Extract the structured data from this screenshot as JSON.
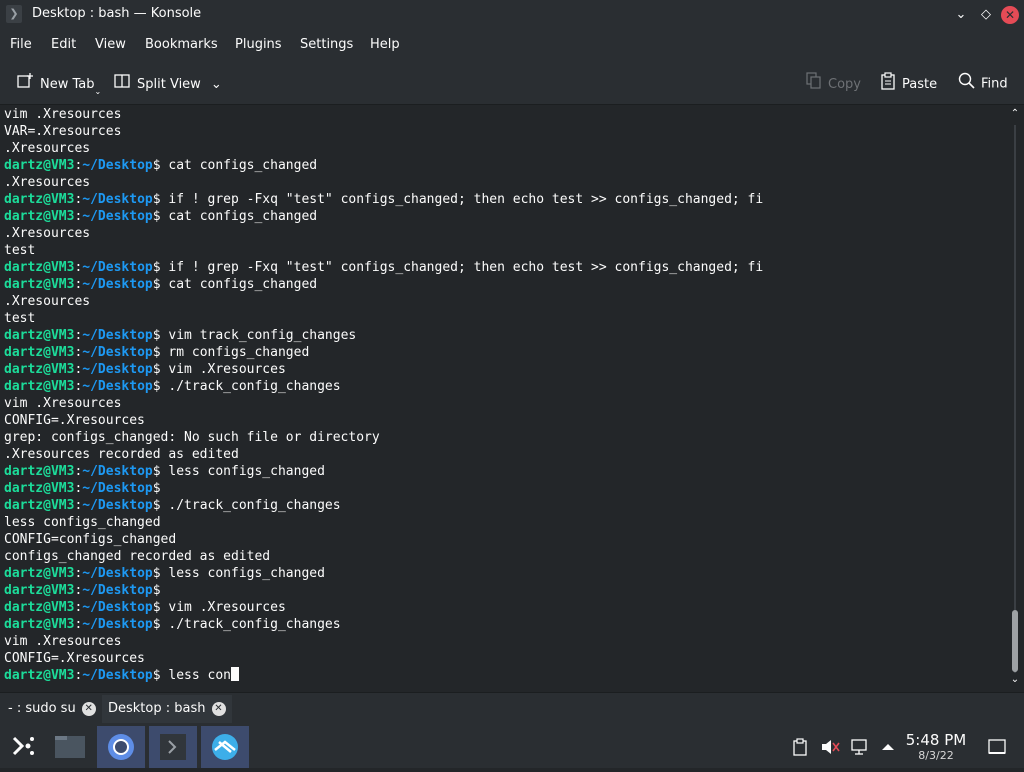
{
  "window": {
    "title": "Desktop : bash — Konsole"
  },
  "menu": [
    "File",
    "Edit",
    "View",
    "Bookmarks",
    "Plugins",
    "Settings",
    "Help"
  ],
  "toolbar": {
    "new_tab": "New Tab",
    "split_view": "Split View",
    "copy": "Copy",
    "paste": "Paste",
    "find": "Find"
  },
  "prompt": {
    "user_host": "dartz@VM3",
    "sep": ":",
    "path": "~/Desktop",
    "symbol": "$"
  },
  "terminal_lines": [
    {
      "type": "out",
      "text": "vim .Xresources"
    },
    {
      "type": "out",
      "text": "VAR=.Xresources"
    },
    {
      "type": "out",
      "text": ".Xresources"
    },
    {
      "type": "cmd",
      "text": "cat configs_changed"
    },
    {
      "type": "out",
      "text": ".Xresources"
    },
    {
      "type": "cmd",
      "text": "if ! grep -Fxq \"test\" configs_changed; then echo test >> configs_changed; fi"
    },
    {
      "type": "cmd",
      "text": "cat configs_changed"
    },
    {
      "type": "out",
      "text": ".Xresources"
    },
    {
      "type": "out",
      "text": "test"
    },
    {
      "type": "cmd",
      "text": "if ! grep -Fxq \"test\" configs_changed; then echo test >> configs_changed; fi"
    },
    {
      "type": "cmd",
      "text": "cat configs_changed"
    },
    {
      "type": "out",
      "text": ".Xresources"
    },
    {
      "type": "out",
      "text": "test"
    },
    {
      "type": "cmd",
      "text": "vim track_config_changes"
    },
    {
      "type": "cmd",
      "text": "rm configs_changed"
    },
    {
      "type": "cmd",
      "text": "vim .Xresources"
    },
    {
      "type": "cmd",
      "text": "./track_config_changes"
    },
    {
      "type": "out",
      "text": "vim .Xresources"
    },
    {
      "type": "out",
      "text": "CONFIG=.Xresources"
    },
    {
      "type": "out",
      "text": "grep: configs_changed: No such file or directory"
    },
    {
      "type": "out",
      "text": ".Xresources recorded as edited"
    },
    {
      "type": "cmd",
      "text": "less configs_changed"
    },
    {
      "type": "cmd",
      "text": ""
    },
    {
      "type": "cmd",
      "text": "./track_config_changes"
    },
    {
      "type": "out",
      "text": "less configs_changed"
    },
    {
      "type": "out",
      "text": "CONFIG=configs_changed"
    },
    {
      "type": "out",
      "text": "configs_changed recorded as edited"
    },
    {
      "type": "cmd",
      "text": "less configs_changed"
    },
    {
      "type": "cmd",
      "text": ""
    },
    {
      "type": "cmd",
      "text": "vim .Xresources"
    },
    {
      "type": "cmd",
      "text": "./track_config_changes"
    },
    {
      "type": "out",
      "text": "vim .Xresources"
    },
    {
      "type": "out",
      "text": "CONFIG=.Xresources"
    },
    {
      "type": "cur",
      "text": "less con"
    }
  ],
  "tabs": [
    {
      "label": "- : sudo su",
      "active": false
    },
    {
      "label": "Desktop : bash",
      "active": true
    }
  ],
  "taskbar": {
    "tasks": [
      "app-launcher-icon",
      "file-manager-icon",
      "chromium-icon",
      "konsole-icon",
      "browser-icon"
    ],
    "time": "5:48 PM",
    "date": "8/3/22"
  },
  "colors": {
    "prompt_user": "#1cdc9a",
    "prompt_path": "#1d99f3",
    "bg": "#232629",
    "close": "#e54b56"
  }
}
